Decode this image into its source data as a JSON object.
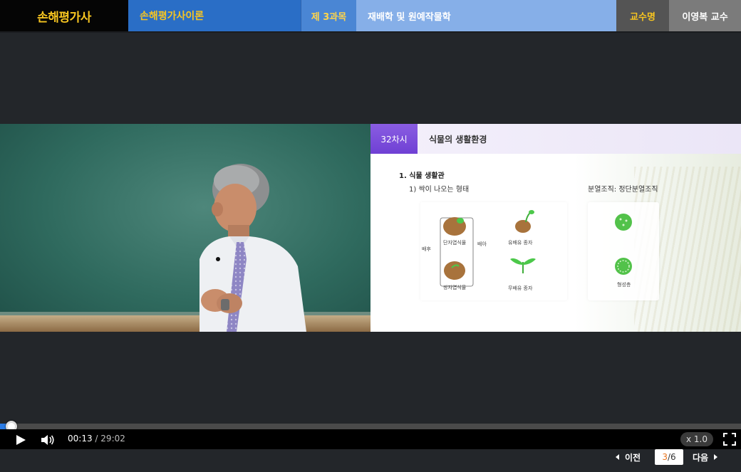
{
  "header": {
    "brand": "손해평가사",
    "course": "손해평가사이론",
    "subject_no": "제 3과목",
    "subject_name": "재배학 및 원예작물학",
    "professor_label": "교수명",
    "professor_name": "이영복 교수"
  },
  "slide": {
    "badge": "32차시",
    "title": "식물의 생활환경",
    "heading": "1. 식물 생활관",
    "subheading": "1) 싹이 나오는 형태",
    "right_heading": "분열조직: 정단분열조직",
    "labels": {
      "baehu": "배후",
      "baea": "배아",
      "monocot": "단자엽식물",
      "dicot": "쌍자엽식물",
      "endosperm": "유배유 종자",
      "no_endosperm": "무배유 종자",
      "cambium": "형성층"
    }
  },
  "player": {
    "current_time": "00:13",
    "separator": "/",
    "total_time": "29:02",
    "progress_fraction": 0.0075,
    "speed": "x 1.0"
  },
  "pagination": {
    "prev_label": "이전",
    "current": "3",
    "slash": "/",
    "total": "6",
    "next_label": "다음"
  },
  "colors": {
    "brand_yellow": "#f7c520",
    "header_blue": "#2a6ec6",
    "accent_purple": "#7a4cdc",
    "progress_blue": "#2a7be4",
    "page_orange": "#e8731c"
  }
}
